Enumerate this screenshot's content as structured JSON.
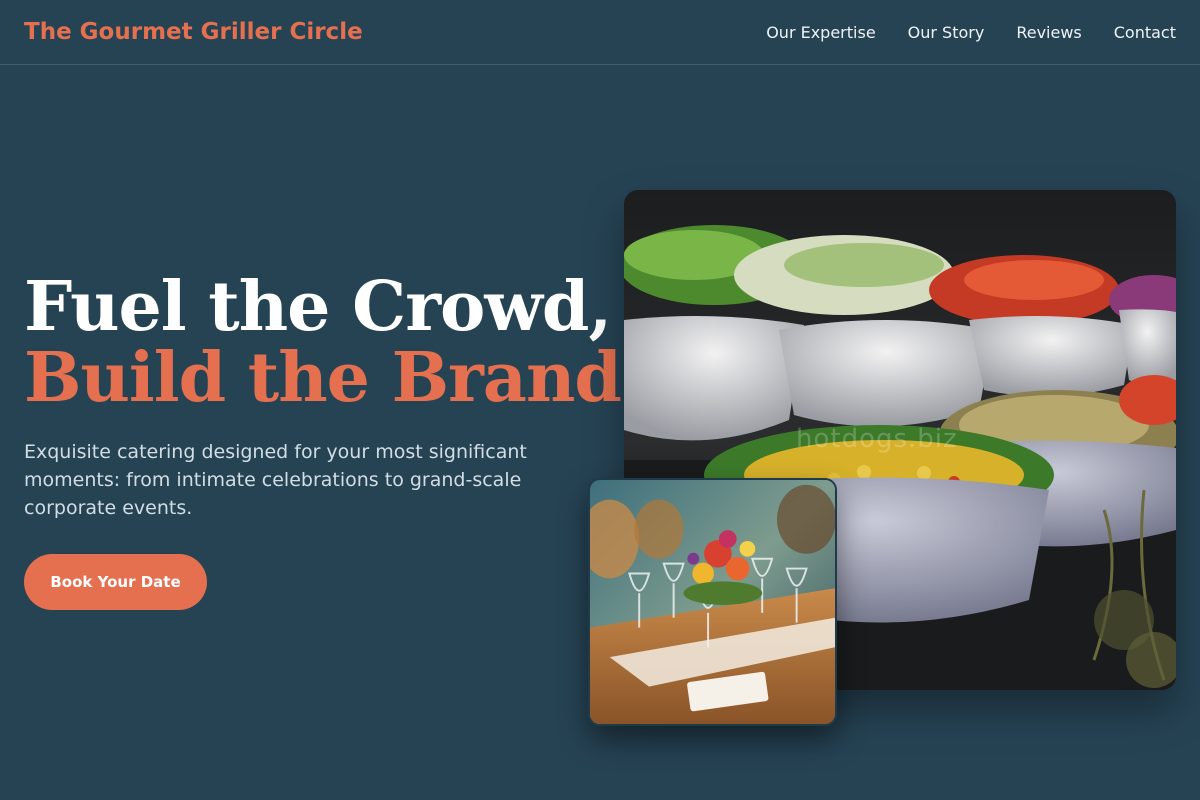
{
  "header": {
    "brand": "The Gourmet Griller Circle",
    "nav": [
      "Our Expertise",
      "Our Story",
      "Reviews",
      "Contact"
    ]
  },
  "hero": {
    "title_line1": "Fuel the Crowd,",
    "title_line2": "Build the Brand.",
    "subtitle": "Exquisite catering designed for your most significant moments: from intimate celebrations to grand-scale corporate events.",
    "cta_label": "Book Your Date"
  },
  "images": {
    "main_alt": "Buffet of salad bowls with cucumbers, tomatoes, corn and herbs",
    "small_alt": "Elegant dinner table with glassware and flower centerpiece",
    "watermark": "hotdogs.biz"
  },
  "colors": {
    "background": "#264354",
    "accent": "#e5704f",
    "text": "#ffffff",
    "muted_text": "#d2dde4"
  }
}
